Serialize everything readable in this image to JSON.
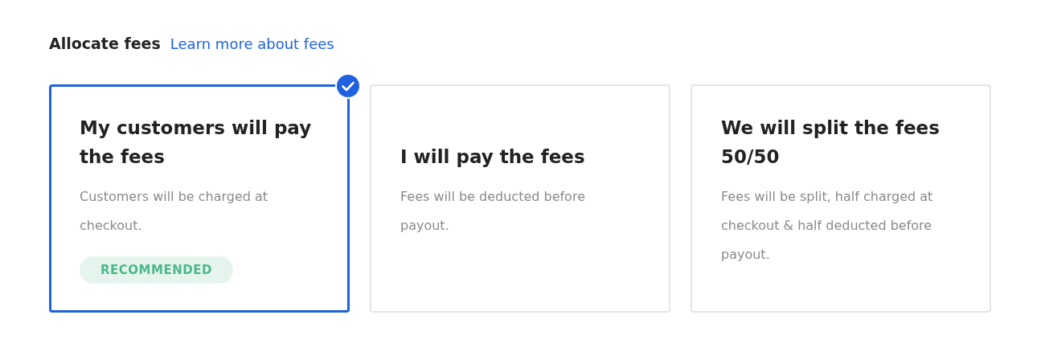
{
  "header": {
    "title": "Allocate fees",
    "link": "Learn more about fees"
  },
  "options": [
    {
      "title": "My customers will pay the fees",
      "description": "Customers will be charged at checkout.",
      "badge": "RECOMMENDED",
      "selected": true
    },
    {
      "title": "I will pay the fees",
      "description": "Fees will be deducted before payout.",
      "selected": false
    },
    {
      "title": "We will split the fees 50/50",
      "description": "Fees will be split, half charged at checkout & half deducted before payout.",
      "selected": false
    }
  ]
}
